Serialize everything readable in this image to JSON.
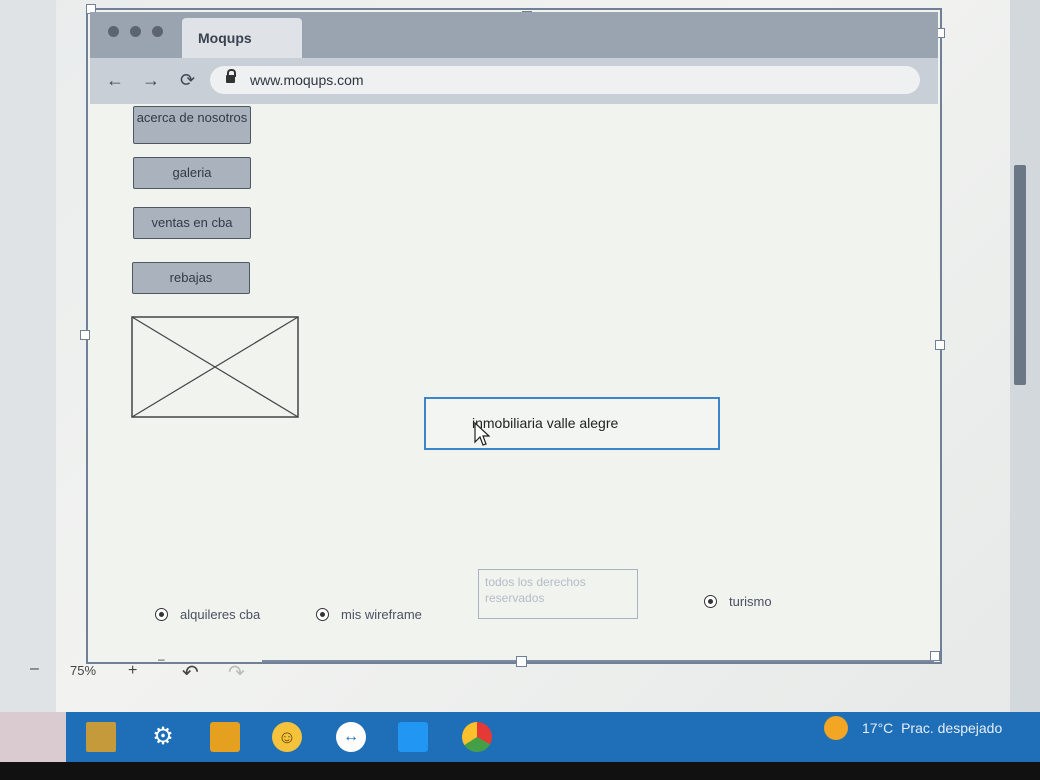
{
  "browser": {
    "tab_title": "Moqups",
    "url": "www.moqups.com"
  },
  "sidebar": {
    "buttons": [
      {
        "label": "acerca de nosotros"
      },
      {
        "label": "galeria"
      },
      {
        "label": "ventas en cba"
      },
      {
        "label": "rebajas"
      }
    ]
  },
  "main": {
    "title_box": "inmobiliaria valle alegre",
    "faint_box": "todos los derechos reservados"
  },
  "radios": [
    {
      "label": "alquileres cba"
    },
    {
      "label": "mis wireframe"
    },
    {
      "label": "turismo"
    }
  ],
  "editor": {
    "zoom": "75%"
  },
  "taskbar": {
    "temperature": "17°C",
    "weather": "Prac. despejado"
  },
  "colors": {
    "canvas_border": "#6f8097",
    "selection_blue": "#3a86c8",
    "taskbar_blue": "#1f6fb8"
  }
}
